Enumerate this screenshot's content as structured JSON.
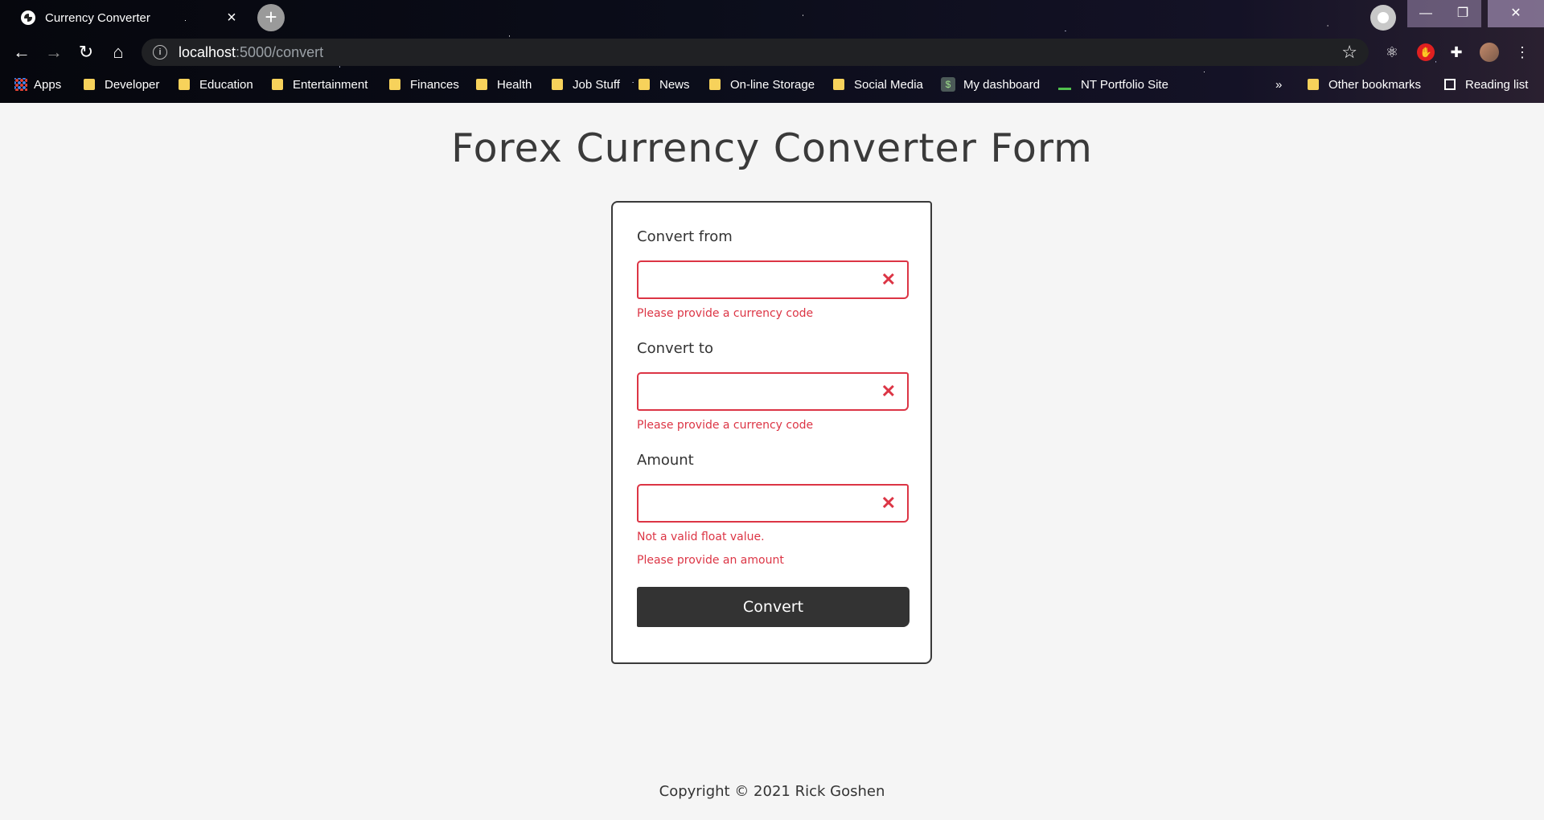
{
  "browser": {
    "tab_title": "Currency Converter",
    "tab_close": "×",
    "new_tab": "+",
    "url_host": "localhost",
    "url_path": ":5000/convert",
    "bookmarks": [
      {
        "label": "Apps",
        "icon": "apps-grid-icon"
      },
      {
        "label": "Developer",
        "icon": "folder-icon"
      },
      {
        "label": "Education",
        "icon": "folder-icon"
      },
      {
        "label": "Entertainment",
        "icon": "folder-icon"
      },
      {
        "label": "Finances",
        "icon": "folder-icon"
      },
      {
        "label": "Health",
        "icon": "folder-icon"
      },
      {
        "label": "Job Stuff",
        "icon": "folder-icon"
      },
      {
        "label": "News",
        "icon": "folder-icon"
      },
      {
        "label": "On-line Storage",
        "icon": "folder-icon"
      },
      {
        "label": "Social Media",
        "icon": "folder-icon"
      },
      {
        "label": "My dashboard",
        "icon": "dashboard-icon"
      },
      {
        "label": "NT Portfolio Site",
        "icon": "portfolio-icon"
      }
    ],
    "bookmarks_overflow": "»",
    "other_bookmarks": "Other bookmarks",
    "reading_list": "Reading list"
  },
  "page": {
    "title": "Forex Currency Converter Form",
    "form": {
      "from_label": "Convert from",
      "from_error": "Please provide a currency code",
      "to_label": "Convert to",
      "to_error": "Please provide a currency code",
      "amount_label": "Amount",
      "amount_error_1": "Not a valid float value.",
      "amount_error_2": "Please provide an amount",
      "submit_label": "Convert",
      "invalid_mark": "✕"
    },
    "footer": "Copyright © 2021 Rick Goshen"
  },
  "colors": {
    "error": "#dc3545",
    "button": "#333333",
    "page_background": "#f5f5f5"
  }
}
